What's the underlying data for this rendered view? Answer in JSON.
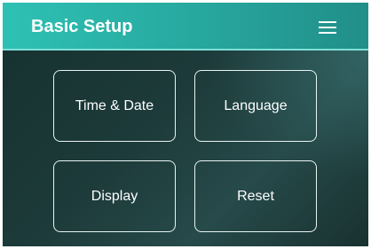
{
  "header": {
    "title": "Basic Setup",
    "menu_icon": "hamburger-menu-icon",
    "color": "#2ec1b3"
  },
  "tiles": [
    {
      "label": "Time & Date"
    },
    {
      "label": "Language"
    },
    {
      "label": "Display"
    },
    {
      "label": "Reset"
    }
  ]
}
